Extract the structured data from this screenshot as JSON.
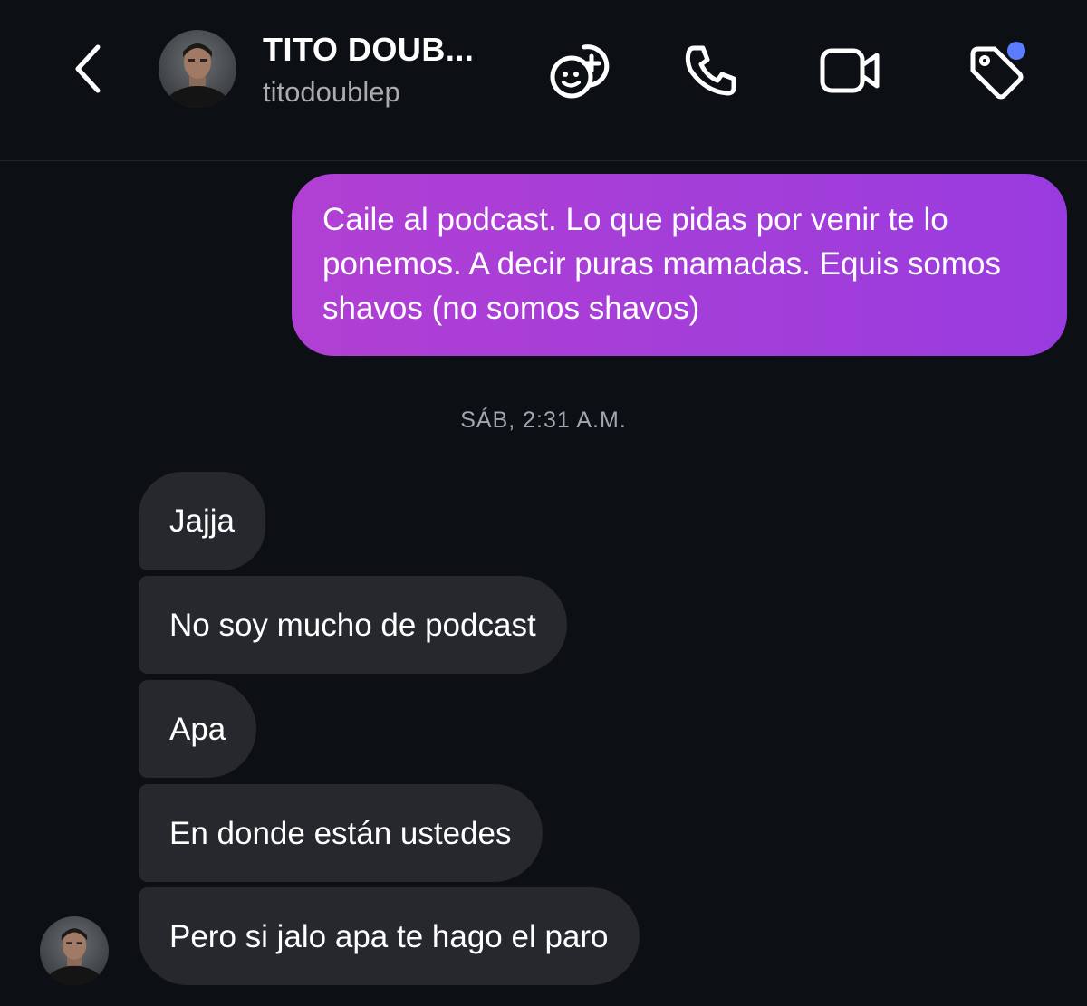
{
  "header": {
    "contact_name": "TITO DOUB...",
    "contact_handle": "titodoublep",
    "icons": {
      "back": "chevron-left-icon",
      "effects": "sticker-add-icon",
      "call": "phone-icon",
      "video": "video-camera-icon",
      "tag": "tag-icon"
    },
    "notification_dot_color": "#5b7cff"
  },
  "messages": {
    "outgoing_1": "Caile al podcast. Lo que pidas por venir te lo ponemos. A decir puras mamadas. Equis somos shavos (no somos shavos)",
    "timestamp": "SÁB, 2:31 A.M.",
    "incoming_1": "Jajja",
    "incoming_2": "No soy mucho de podcast",
    "incoming_3": "Apa",
    "incoming_4": "En donde están ustedes",
    "incoming_5": "Pero si jalo apa te hago el paro"
  },
  "colors": {
    "background": "#0c0f14",
    "outgoing_bubble": "#a93ed8",
    "incoming_bubble": "#26282e"
  }
}
